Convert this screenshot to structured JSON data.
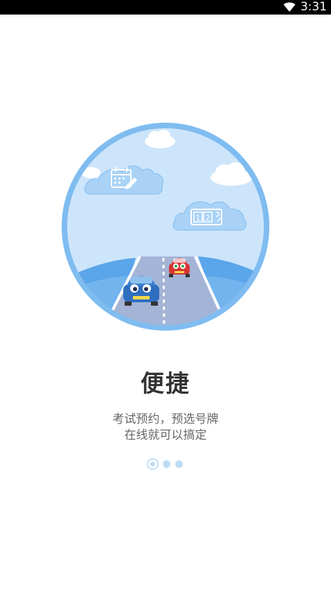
{
  "status_bar": {
    "time": "3:31",
    "wifi_icon": "wifi-icon"
  },
  "illustration": {
    "icons": [
      "calendar-edit-icon",
      "license-plate-icon",
      "blue-car-icon",
      "red-car-icon"
    ],
    "cloud_1_label": "",
    "plate_digits": "12"
  },
  "onboarding": {
    "title": "便捷",
    "subtitle_line1": "考试预约，预选号牌",
    "subtitle_line2": "在线就可以搞定"
  },
  "pager": {
    "current_page": 1,
    "total_pages": 3
  },
  "colors": {
    "sky": "#cde5fb",
    "ring": "#7fbcf0",
    "road": "#a3b4d6",
    "blue_car": "#3c7fce",
    "red_car": "#e23c3c",
    "title": "#333333",
    "subtitle": "#666666"
  }
}
